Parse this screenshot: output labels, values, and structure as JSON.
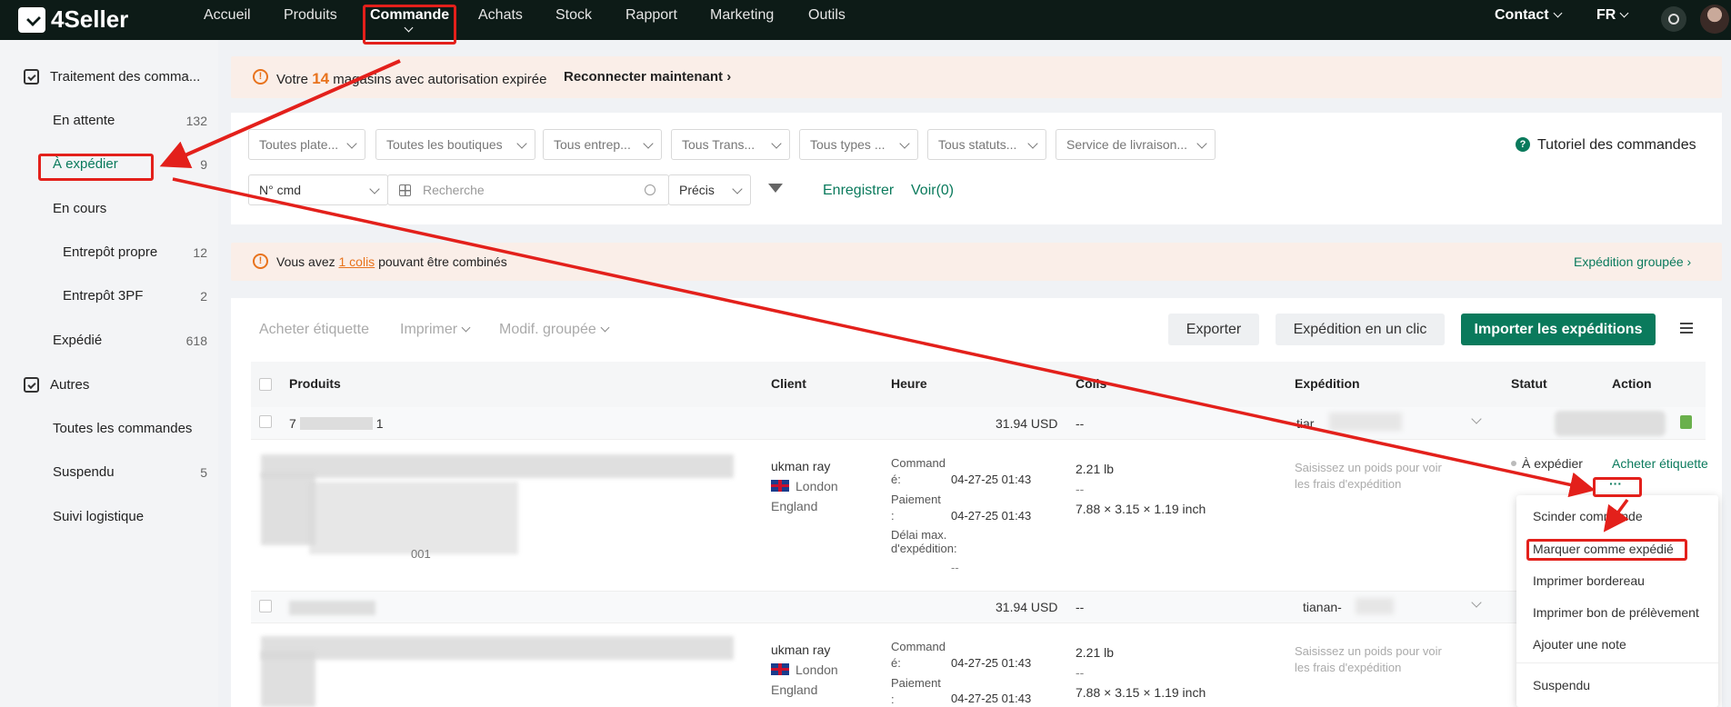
{
  "app": {
    "brand": "4Seller"
  },
  "topnav": {
    "items": [
      "Accueil",
      "Produits",
      "Commande",
      "Achats",
      "Stock",
      "Rapport",
      "Marketing",
      "Outils"
    ],
    "active": "Commande",
    "contact": "Contact",
    "lang": "FR"
  },
  "sidebar": {
    "section1": "Traitement des comma...",
    "items": [
      {
        "label": "En attente",
        "count": "132"
      },
      {
        "label": "À expédier",
        "count": "9"
      },
      {
        "label": "En cours",
        "count": ""
      },
      {
        "label": "Entrepôt propre",
        "count": "12"
      },
      {
        "label": "Entrepôt 3PF",
        "count": "2"
      },
      {
        "label": "Expédié",
        "count": "618"
      }
    ],
    "section2": "Autres",
    "items2": [
      {
        "label": "Toutes les commandes",
        "count": ""
      },
      {
        "label": "Suspendu",
        "count": "5"
      },
      {
        "label": "Suivi logistique",
        "count": ""
      }
    ]
  },
  "alert1": {
    "prefix": "Votre",
    "count": "14",
    "suffix": "magasins avec autorisation expirée",
    "action": "Reconnecter maintenant"
  },
  "filters": {
    "dropdowns": [
      "Toutes plate...",
      "Toutes les boutiques",
      "Tous entrep...",
      "Tous Trans...",
      "Tous types ...",
      "Tous statuts...",
      "Service de livraison..."
    ],
    "tutorial": "Tutoriel des commandes",
    "search_field": "N° cmd",
    "search_placeholder": "Recherche",
    "match": "Précis",
    "save": "Enregistrer",
    "view": "Voir(0)"
  },
  "alert2": {
    "prefix": "Vous avez",
    "link": "1 colis",
    "suffix": "pouvant être combinés",
    "action": "Expédition groupée"
  },
  "toolbar": {
    "buy_label": "Acheter étiquette",
    "print": "Imprimer",
    "bulk": "Modif. groupée",
    "export": "Exporter",
    "oneclick": "Expédition en un clic",
    "import": "Importer les expéditions"
  },
  "table": {
    "headers": [
      "Produits",
      "Client",
      "Heure",
      "Colis",
      "Expédition",
      "Statut",
      "Action"
    ],
    "orders": [
      {
        "order_no_prefix": "7",
        "order_no_suffix": "1",
        "total": "31.94 USD",
        "parcel_header": "--",
        "carrier": "tiar",
        "sku_tail": "001",
        "client": "ukman ray",
        "city": "London",
        "region": "England",
        "ordered_label": "Command é:",
        "ordered_time": "04-27-25 01:43",
        "paid_label": "Paiement :",
        "paid_time": "04-27-25 01:43",
        "deadline_label": "Délai max. d'expédition:",
        "deadline_value": "--",
        "weight": "2.21 lb",
        "parcel_dash": "--",
        "dims": "7.88 × 3.15 × 1.19 inch",
        "shipping_hint": "Saisissez un poids pour voir les frais d'expédition",
        "status": "À expédier",
        "action": "Acheter étiquette",
        "more": "···"
      },
      {
        "total": "31.94 USD",
        "parcel_header": "--",
        "carrier": "tianan-",
        "client": "ukman ray",
        "city": "London",
        "region": "England",
        "ordered_label": "Command é:",
        "ordered_time": "04-27-25 01:43",
        "paid_label": "Paiement :",
        "paid_time": "04-27-25 01:43",
        "weight": "2.21 lb",
        "parcel_dash": "--",
        "dims": "7.88 × 3.15 × 1.19 inch",
        "shipping_hint": "Saisissez un poids pour voir les frais d'expédition"
      }
    ]
  },
  "action_menu": [
    "Scinder commande",
    "Marquer comme expédié",
    "Imprimer bordereau",
    "Imprimer bon de prélèvement",
    "Ajouter une note",
    "Suspendu"
  ],
  "colors": {
    "brand_green": "#0a7a5c",
    "topbar": "#0d1b17",
    "warning": "#e8731d",
    "annotation_red": "#e3201b"
  }
}
